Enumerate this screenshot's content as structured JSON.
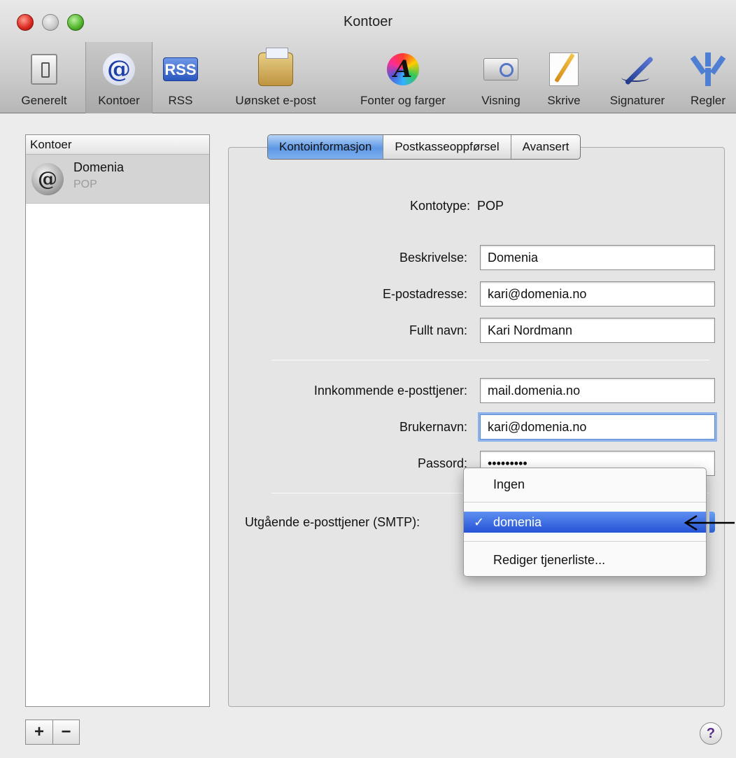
{
  "window": {
    "title": "Kontoer"
  },
  "toolbar": {
    "items": [
      {
        "label": "Generelt",
        "icon": "general-switch-icon"
      },
      {
        "label": "Kontoer",
        "icon": "at-sign-icon",
        "selected": true
      },
      {
        "label": "RSS",
        "icon": "rss-icon",
        "icon_text": "RSS"
      },
      {
        "label": "Uønsket e-post",
        "icon": "junk-mail-icon"
      },
      {
        "label": "Fonter og farger",
        "icon": "fonts-colors-icon",
        "icon_text": "A"
      },
      {
        "label": "Visning",
        "icon": "viewing-icon"
      },
      {
        "label": "Skrive",
        "icon": "composing-icon"
      },
      {
        "label": "Signaturer",
        "icon": "signature-pen-icon"
      },
      {
        "label": "Regler",
        "icon": "rules-icon"
      }
    ]
  },
  "accounts": {
    "header": "Kontoer",
    "items": [
      {
        "name": "Domenia",
        "type": "POP",
        "icon_text": "@"
      }
    ],
    "add_label": "+",
    "remove_label": "−"
  },
  "tabs": [
    {
      "label": "Kontoinformasjon",
      "active": true
    },
    {
      "label": "Postkasseoppførsel",
      "active": false
    },
    {
      "label": "Avansert",
      "active": false
    }
  ],
  "form": {
    "account_type_label": "Kontotype:",
    "account_type_value": "POP",
    "description_label": "Beskrivelse:",
    "description_value": "Domenia",
    "email_label": "E-postadresse:",
    "email_value": "kari@domenia.no",
    "fullname_label": "Fullt navn:",
    "fullname_value": "Kari Nordmann",
    "incoming_label": "Innkommende e-posttjener:",
    "incoming_value": "mail.domenia.no",
    "username_label": "Brukernavn:",
    "username_value": "kari@domenia.no",
    "password_label": "Passord:",
    "password_value": "•••••••••",
    "smtp_label": "Utgående e-posttjener (SMTP):"
  },
  "smtp_menu": {
    "items": [
      {
        "label": "Ingen"
      },
      {
        "label": "domenia",
        "checked": true,
        "check": "✓"
      },
      {
        "label": "Rediger tjenerliste..."
      }
    ]
  },
  "help": {
    "label": "?"
  },
  "colors": {
    "menu_highlight": "#2553d6",
    "tab_active": "#5e98e5",
    "focus_ring": "#6ea0eb"
  }
}
